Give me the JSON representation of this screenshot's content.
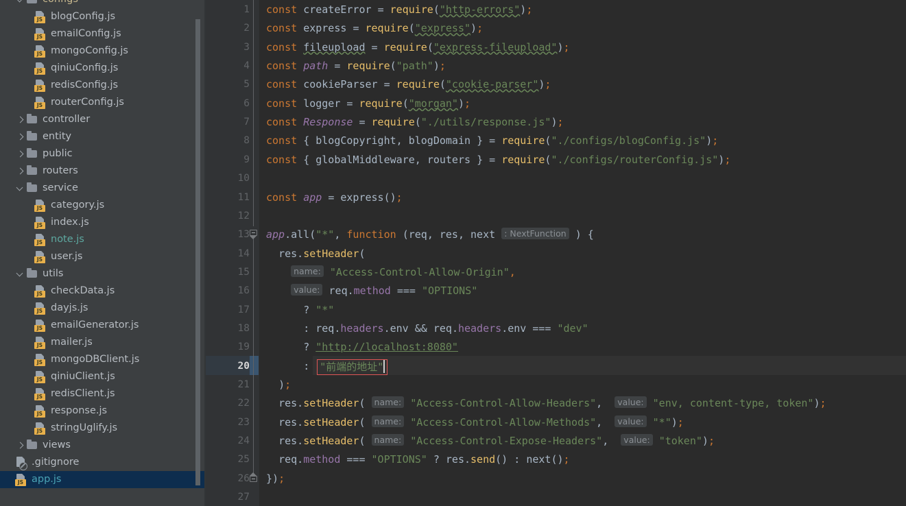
{
  "app": {
    "theme": "darcula",
    "colors": {
      "sidebar_bg": "#3c3f41",
      "editor_bg": "#2b2b2b",
      "gutter_bg": "#313335",
      "selection_bg": "#0d2d4e",
      "active_line_bg": "#323232",
      "accent_keyword": "#cc7832",
      "accent_string": "#6a8759",
      "accent_function": "#e8bf6a",
      "accent_property": "#9876aa",
      "error_border": "#e05555",
      "modified_file": "#5da8a0",
      "selected_file_text": "#4aa3b5",
      "js_badge": "#e8b04b"
    }
  },
  "sidebar": {
    "name": "project-tree",
    "scrollbar": {
      "name": "sidebar-scrollbar"
    },
    "items": [
      {
        "label": "configs",
        "type": "folder",
        "depth": 1,
        "expanded": true,
        "style": "pkg"
      },
      {
        "label": "blogConfig.js",
        "type": "js",
        "depth": 2
      },
      {
        "label": "emailConfig.js",
        "type": "js",
        "depth": 2
      },
      {
        "label": "mongoConfig.js",
        "type": "js",
        "depth": 2
      },
      {
        "label": "qiniuConfig.js",
        "type": "js",
        "depth": 2
      },
      {
        "label": "redisConfig.js",
        "type": "js",
        "depth": 2
      },
      {
        "label": "routerConfig.js",
        "type": "js",
        "depth": 2
      },
      {
        "label": "controller",
        "type": "folder",
        "depth": 1,
        "expanded": false
      },
      {
        "label": "entity",
        "type": "folder",
        "depth": 1,
        "expanded": false
      },
      {
        "label": "public",
        "type": "folder",
        "depth": 1,
        "expanded": false
      },
      {
        "label": "routers",
        "type": "folder",
        "depth": 1,
        "expanded": false
      },
      {
        "label": "service",
        "type": "folder",
        "depth": 1,
        "expanded": true
      },
      {
        "label": "category.js",
        "type": "js",
        "depth": 2
      },
      {
        "label": "index.js",
        "type": "js",
        "depth": 2
      },
      {
        "label": "note.js",
        "type": "js",
        "depth": 2,
        "style": "modified"
      },
      {
        "label": "user.js",
        "type": "js",
        "depth": 2
      },
      {
        "label": "utils",
        "type": "folder",
        "depth": 1,
        "expanded": true
      },
      {
        "label": "checkData.js",
        "type": "js",
        "depth": 2
      },
      {
        "label": "dayjs.js",
        "type": "js",
        "depth": 2
      },
      {
        "label": "emailGenerator.js",
        "type": "js",
        "depth": 2
      },
      {
        "label": "mailer.js",
        "type": "js",
        "depth": 2
      },
      {
        "label": "mongoDBClient.js",
        "type": "js",
        "depth": 2
      },
      {
        "label": "qiniuClient.js",
        "type": "js",
        "depth": 2
      },
      {
        "label": "redisClient.js",
        "type": "js",
        "depth": 2
      },
      {
        "label": "response.js",
        "type": "js",
        "depth": 2
      },
      {
        "label": "stringUglify.js",
        "type": "js",
        "depth": 2
      },
      {
        "label": "views",
        "type": "folder",
        "depth": 1,
        "expanded": false
      },
      {
        "label": ".gitignore",
        "type": "gitignore",
        "depth": 1
      },
      {
        "label": "app.js",
        "type": "js",
        "depth": 1,
        "selected": true,
        "style": "sel"
      }
    ]
  },
  "editor": {
    "name": "code-editor",
    "file": "app.js",
    "active_line": 20,
    "first_line": 1,
    "last_line": 27,
    "line_numbers": [
      1,
      2,
      3,
      4,
      5,
      6,
      7,
      8,
      9,
      10,
      11,
      12,
      13,
      14,
      15,
      16,
      17,
      18,
      19,
      20,
      21,
      22,
      23,
      24,
      25,
      26,
      27
    ],
    "lines": [
      {
        "n": 1,
        "text": "const createError = require(\"http-errors\");"
      },
      {
        "n": 2,
        "text": "const express = require(\"express\");"
      },
      {
        "n": 3,
        "text": "const fileupload = require(\"express-fileupload\");"
      },
      {
        "n": 4,
        "text": "const path = require(\"path\");"
      },
      {
        "n": 5,
        "text": "const cookieParser = require(\"cookie-parser\");"
      },
      {
        "n": 6,
        "text": "const logger = require(\"morgan\");"
      },
      {
        "n": 7,
        "text": "const Response = require(\"./utils/response.js\");"
      },
      {
        "n": 8,
        "text": "const { blogCopyright, blogDomain } = require(\"./configs/blogConfig.js\");"
      },
      {
        "n": 9,
        "text": "const { globalMiddleware, routers } = require(\"./configs/routerConfig.js\");"
      },
      {
        "n": 10,
        "text": ""
      },
      {
        "n": 11,
        "text": "const app = express();"
      },
      {
        "n": 12,
        "text": ""
      },
      {
        "n": 13,
        "text": "app.all(\"*\", function (req, res, next : NextFunction ) {"
      },
      {
        "n": 14,
        "text": "  res.setHeader("
      },
      {
        "n": 15,
        "text": "    name: \"Access-Control-Allow-Origin\","
      },
      {
        "n": 16,
        "text": "    value: req.method === \"OPTIONS\""
      },
      {
        "n": 17,
        "text": "      ? \"*\""
      },
      {
        "n": 18,
        "text": "      : req.headers.env && req.headers.env === \"dev\""
      },
      {
        "n": 19,
        "text": "      ? \"http://localhost:8080\""
      },
      {
        "n": 20,
        "text": "      : \"前端的地址\""
      },
      {
        "n": 21,
        "text": "  );"
      },
      {
        "n": 22,
        "text": "  res.setHeader( name: \"Access-Control-Allow-Headers\",  value: \"env, content-type, token\");"
      },
      {
        "n": 23,
        "text": "  res.setHeader( name: \"Access-Control-Allow-Methods\",  value: \"*\");"
      },
      {
        "n": 24,
        "text": "  res.setHeader( name: \"Access-Control-Expose-Headers\",  value: \"token\");"
      },
      {
        "n": 25,
        "text": "  req.method === \"OPTIONS\" ? res.send() : next();"
      },
      {
        "n": 26,
        "text": "});"
      },
      {
        "n": 27,
        "text": ""
      }
    ],
    "inlay_hints": [
      "NextFunction",
      "name:",
      "value:"
    ],
    "error_marker": {
      "name": "error-highlight",
      "line": 20,
      "text": "\"前端的地址\""
    }
  }
}
